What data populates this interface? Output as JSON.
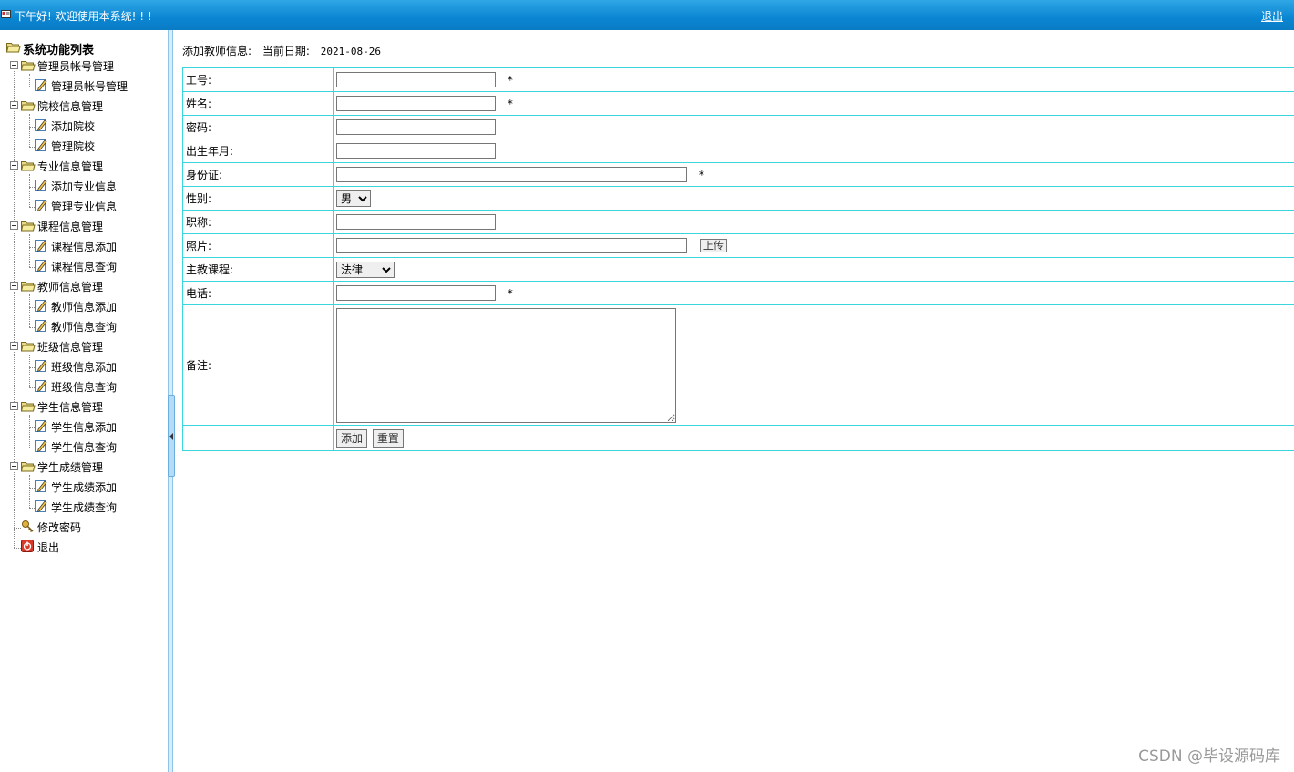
{
  "header": {
    "greeting": "下午好! 欢迎使用本系统! ! !",
    "logout_label": "退出",
    "bg_color": "#0b86d2"
  },
  "sidebar": {
    "root_label": "系统功能列表",
    "groups": [
      {
        "label": "管理员帐号管理",
        "items": [
          "管理员帐号管理"
        ]
      },
      {
        "label": "院校信息管理",
        "items": [
          "添加院校",
          "管理院校"
        ]
      },
      {
        "label": "专业信息管理",
        "items": [
          "添加专业信息",
          "管理专业信息"
        ]
      },
      {
        "label": "课程信息管理",
        "items": [
          "课程信息添加",
          "课程信息查询"
        ]
      },
      {
        "label": "教师信息管理",
        "items": [
          "教师信息添加",
          "教师信息查询"
        ]
      },
      {
        "label": "班级信息管理",
        "items": [
          "班级信息添加",
          "班级信息查询"
        ]
      },
      {
        "label": "学生信息管理",
        "items": [
          "学生信息添加",
          "学生信息查询"
        ]
      },
      {
        "label": "学生成绩管理",
        "items": [
          "学生成绩添加",
          "学生成绩查询"
        ]
      }
    ],
    "extra": [
      "修改密码",
      "退出"
    ]
  },
  "form": {
    "title": "添加教师信息:",
    "date_label": "当前日期:",
    "date": "2021-08-26",
    "required_mark": "*",
    "fields": {
      "job_no": {
        "label": "工号:",
        "value": ""
      },
      "name": {
        "label": "姓名:",
        "value": ""
      },
      "password": {
        "label": "密码:",
        "value": ""
      },
      "birth": {
        "label": "出生年月:",
        "value": ""
      },
      "id_card": {
        "label": "身份证:",
        "value": ""
      },
      "gender": {
        "label": "性别:",
        "value": "男"
      },
      "title": {
        "label": "职称:",
        "value": ""
      },
      "photo": {
        "label": "照片:",
        "value": "",
        "upload_label": "上传"
      },
      "course": {
        "label": "主教课程:",
        "value": "法律"
      },
      "phone": {
        "label": "电话:",
        "value": ""
      },
      "remark": {
        "label": "备注:",
        "value": ""
      }
    },
    "add_label": "添加",
    "reset_label": "重置"
  },
  "watermark": "CSDN @毕设源码库",
  "colors": {
    "table_border": "#3bd6db",
    "splitter": "#d6ecfb"
  }
}
